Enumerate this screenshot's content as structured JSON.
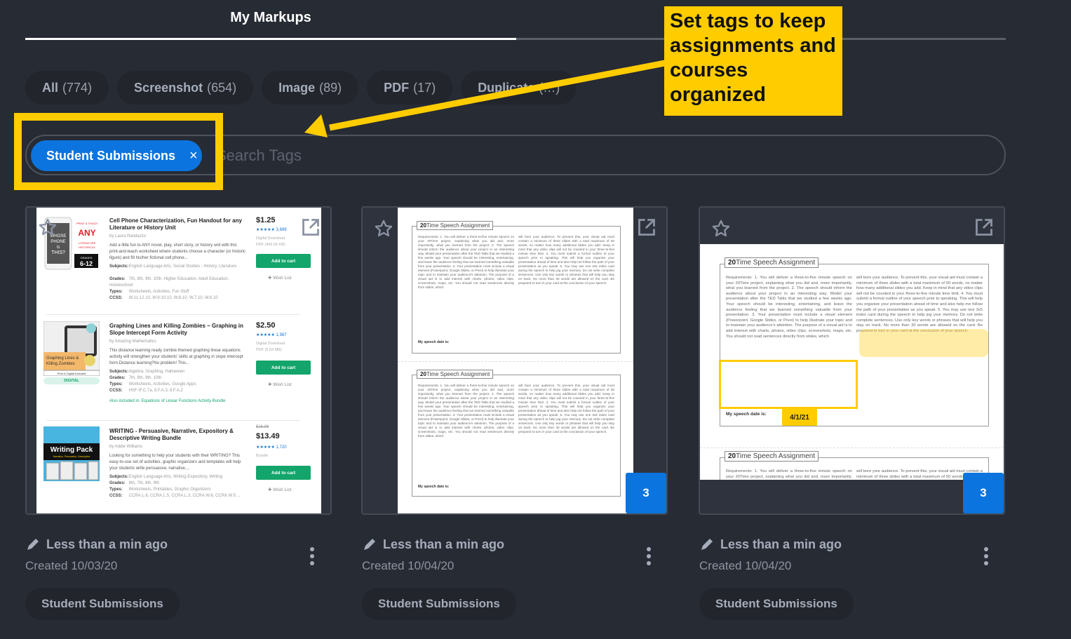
{
  "tabs": {
    "active": "My Markups"
  },
  "filters": [
    {
      "label": "All",
      "count": "(774)"
    },
    {
      "label": "Screenshot",
      "count": "(654)"
    },
    {
      "label": "Image",
      "count": "(89)"
    },
    {
      "label": "PDF",
      "count": "(17)"
    },
    {
      "label": "Duplicate",
      "count": "(…)"
    }
  ],
  "tag_search": {
    "selected_tag": "Student Submissions",
    "remove_icon": "×",
    "placeholder": "Search Tags"
  },
  "annotation": {
    "callout_text": "Set tags to keep assignments and courses organized",
    "color": "#ffcc00"
  },
  "cards": [
    {
      "edited": "Less than a min ago",
      "created": "Created 10/03/20",
      "tag": "Student Submissions",
      "listings": [
        {
          "title": "Cell Phone Characterization, Fun Handout for any Literature or History Unit",
          "author": "by Laura Randazzo",
          "desc": "Add a little fun to ANY novel, play, short story, or history unit with this print-and-teach worksheet where students choose a character (or historic figure) and fill his/her fictional cell phone...",
          "subjects": "English Language Arts, Social Studies - History, Literature",
          "grades": "7th, 8th, 9th, 10th, Higher Education, Adult Education, Homeschool",
          "types": "Worksheets, Activities, Fun Stuff",
          "ccss": "W.11-12.10, W.9-10.10, W.8.10, W.7.10, W.6.10",
          "price": "$1.25",
          "old_price": "",
          "rating": "★★★★★ 3,699",
          "format": "Digital Download",
          "file": "PDF (406.06 KB)",
          "cart": "Add to cart",
          "wish": "✚ Wish List",
          "thumb_text": "WHOSE PHONE IS THIS? · ANY · GRADES 6-12"
        },
        {
          "title": "Graphing Lines and Killing Zombies ~ Graphing in Slope Intercept Form Activity",
          "author": "by Amazing Mathematics",
          "desc": "This distance learning ready zombie themed graphing linear equations activity will strengthen your students' skills at graphing in slope intercept form.Distance learning?No problem! This...",
          "subjects": "Algebra, Graphing, Halloween",
          "grades": "7th, 8th, 9th, 10th",
          "types": "Worksheets, Activities, Google Apps",
          "ccss": "HSF-IF.C.7a, 8.F.A.3, 8.F.A.2",
          "also": "Also included in: Equations of Linear Functions Activity Bundle",
          "price": "$2.50",
          "old_price": "",
          "rating": "★★★★★ 1,987",
          "format": "Digital Download",
          "file": "PDF (5.54 MB)",
          "cart": "Add to cart",
          "wish": "✚ Wish List",
          "badge": "DIGITAL",
          "thumb_text": "Graphing Lines & Killing Zombies"
        },
        {
          "title": "WRITING - Persuasive, Narrative, Expository & Descriptive Writing Bundle",
          "author": "by Addie Williams",
          "desc": "Looking for something to help your students with their WRITING? This easy-to-use set of activities, graphic organizers and templates will help your students write persuasive, narrative,...",
          "subjects": "English Language Arts, Writing-Expository, Writing",
          "grades": "6th, 7th, 8th, 9th",
          "types": "Worksheets, Printables, Graphic Organizers",
          "ccss": "CCRA.L.6, CCRA.L.5, CCRA.L.3, CCRA.W.6, CCRA.W.5 ...",
          "price": "$13.49",
          "old_price": "$16.96",
          "rating": "★★★★★ 1,720",
          "format": "Bundle",
          "file": "",
          "cart": "Add to cart",
          "wish": "✚ Wish List",
          "thumb_text": "Writing Pack"
        }
      ]
    },
    {
      "edited": "Less than a min ago",
      "created": "Created 10/04/20",
      "tag": "Student Submissions",
      "page_count": "3"
    },
    {
      "edited": "Less than a min ago",
      "created": "Created 10/04/20",
      "tag": "Student Submissions",
      "page_count": "3",
      "speech_date": "4/1/21"
    }
  ],
  "document": {
    "title_bold": "20",
    "title_rest": "Time Speech Assignment",
    "col1": "Requirements: 1. You will deliver a three-to-five minute speech on your 20Time project, explaining what you did and, more importantly, what you learned from the project. 2. The speech should inform the audience about your project in an interesting way. Model your presentation after the TED Talks that we studied a few weeks ago. Your speech should be interesting, entertaining, and leave the audience feeling that we learned something valuable from your presentation. 3. Your presentation must include a visual element (Powerpoint, Google Slides, or Prezi) to help illustrate your topic and to maintain your audience's attention. The purpose of a visual aid is to add interest with charts, photos, video clips, screenshots, maps, etc. You should not read sentences directly from slides, which",
    "col2": "will bore your audience. To prevent this, your visual aid must contain a minimum of three slides with a total maximum of 50 words, no matter how many additional slides you add. Keep in mind that any video clips will not be counted in your three-to-five minute time limit. 4. You must submit a formal outline of your speech prior to speaking. This will help you organize your presentation ahead of time and also help me follow the path of your presentation as you speak. 5. You may use one 3x5 index card during the speech to help jog your memory. Do not write complete sentences. Use only key words or phrases that will help you stay on track. No more than 30 words are allowed on the card. Be prepared to turn in your card at the conclusion of your speech.",
    "date_label": "My speech date is:"
  },
  "colors": {
    "background": "#272b34",
    "accent": "#0b74de",
    "highlight": "#ffcc00",
    "cart_green": "#13a56b"
  }
}
